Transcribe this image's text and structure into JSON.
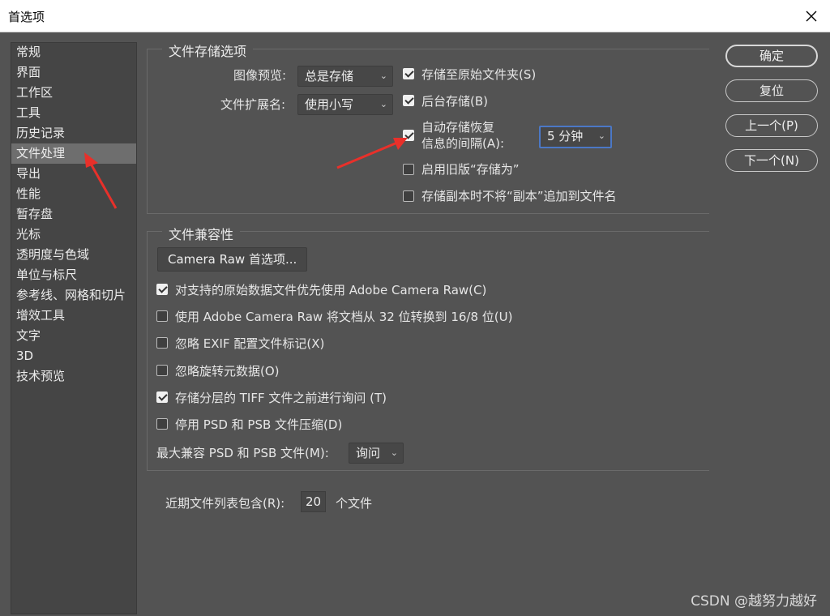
{
  "window": {
    "title": "首选项"
  },
  "sidebar": {
    "items": [
      {
        "label": "常规"
      },
      {
        "label": "界面"
      },
      {
        "label": "工作区"
      },
      {
        "label": "工具"
      },
      {
        "label": "历史记录"
      },
      {
        "label": "文件处理",
        "active": true
      },
      {
        "label": "导出"
      },
      {
        "label": "性能"
      },
      {
        "label": "暂存盘"
      },
      {
        "label": "光标"
      },
      {
        "label": "透明度与色域"
      },
      {
        "label": "单位与标尺"
      },
      {
        "label": "参考线、网格和切片"
      },
      {
        "label": "增效工具"
      },
      {
        "label": "文字"
      },
      {
        "label": "3D"
      },
      {
        "label": "技术预览"
      }
    ]
  },
  "storage": {
    "title": "文件存储选项",
    "image_preview_label": "图像预览:",
    "image_preview_value": "总是存储",
    "extension_label": "文件扩展名:",
    "extension_value": "使用小写",
    "save_to_original": {
      "label": "存储至原始文件夹(S)",
      "checked": true
    },
    "background_save": {
      "label": "后台存储(B)",
      "checked": true
    },
    "auto_save": {
      "label_line1": "自动存储恢复",
      "label_line2": "信息的间隔(A):",
      "checked": true
    },
    "auto_save_interval": "5 分钟",
    "legacy_save_as": {
      "label": "启用旧版“存储为”",
      "checked": false
    },
    "no_copy_suffix": {
      "label": "存储副本时不将“副本”追加到文件名",
      "checked": false
    }
  },
  "compat": {
    "title": "文件兼容性",
    "camera_raw_button": "Camera Raw 首选项...",
    "options": [
      {
        "label": "对支持的原始数据文件优先使用 Adobe Camera Raw(C)",
        "checked": true
      },
      {
        "label": "使用 Adobe Camera Raw 将文档从 32 位转换到 16/8 位(U)",
        "checked": false
      },
      {
        "label": "忽略 EXIF 配置文件标记(X)",
        "checked": false
      },
      {
        "label": "忽略旋转元数据(O)",
        "checked": false
      },
      {
        "label": "存储分层的 TIFF 文件之前进行询问 (T)",
        "checked": true
      },
      {
        "label": "停用 PSD 和 PSB 文件压缩(D)",
        "checked": false
      }
    ],
    "max_compat_label": "最大兼容 PSD 和 PSB 文件(M):",
    "max_compat_value": "询问"
  },
  "recent": {
    "label": "近期文件列表包含(R):",
    "value": "20",
    "suffix": "个文件"
  },
  "buttons": {
    "ok": "确定",
    "reset": "复位",
    "prev": "上一个(P)",
    "next": "下一个(N)"
  },
  "watermark": "CSDN @越努力越好",
  "colors": {
    "background": "#535353",
    "panel": "#454545",
    "annotation_arrow": "#e8302a"
  }
}
